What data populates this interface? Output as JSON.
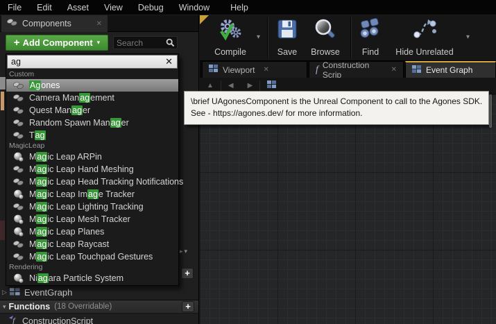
{
  "menu": {
    "items": [
      "File",
      "Edit",
      "Asset",
      "View",
      "Debug",
      "Window",
      "Help"
    ]
  },
  "components_panel": {
    "tab_label": "Components",
    "add_component_label": "Add Component",
    "search_placeholder": "Search"
  },
  "dropdown": {
    "query": "ag",
    "sections": [
      {
        "label": "Custom",
        "items": [
          {
            "icon": "component",
            "selected": true,
            "parts": [
              "",
              "Ag",
              "ones"
            ]
          },
          {
            "icon": "component",
            "parts": [
              "Camera Man",
              "ag",
              "ement"
            ]
          },
          {
            "icon": "component",
            "parts": [
              "Quest Man",
              "ag",
              "er"
            ]
          },
          {
            "icon": "component",
            "parts": [
              "Random Spawn Man",
              "ag",
              "er"
            ]
          },
          {
            "icon": "component",
            "parts": [
              "T",
              "ag",
              ""
            ]
          }
        ]
      },
      {
        "label": "MagicLeap",
        "items": [
          {
            "icon": "scene",
            "parts": [
              "M",
              "ag",
              "ic Leap ARPin"
            ]
          },
          {
            "icon": "component",
            "parts": [
              "M",
              "ag",
              "ic Leap Hand Meshing"
            ]
          },
          {
            "icon": "component",
            "parts": [
              "M",
              "ag",
              "ic Leap Head Tracking Notifications"
            ]
          },
          {
            "icon": "scene",
            "parts": [
              "M",
              "ag",
              "ic Leap Im",
              "ag",
              "e Tracker"
            ]
          },
          {
            "icon": "component",
            "parts": [
              "M",
              "ag",
              "ic Leap Lighting Tracking"
            ]
          },
          {
            "icon": "scene",
            "parts": [
              "M",
              "ag",
              "ic Leap Mesh Tracker"
            ]
          },
          {
            "icon": "scene",
            "parts": [
              "M",
              "ag",
              "ic Leap Planes"
            ]
          },
          {
            "icon": "component",
            "parts": [
              "M",
              "ag",
              "ic Leap Raycast"
            ]
          },
          {
            "icon": "component",
            "parts": [
              "M",
              "ag",
              "ic Leap Touchpad Gestures"
            ]
          }
        ]
      },
      {
        "label": "Rendering",
        "items": [
          {
            "icon": "scene",
            "parts": [
              "Ni",
              "ag",
              "ara Particle System"
            ]
          }
        ]
      }
    ]
  },
  "toolbar": {
    "buttons": [
      {
        "label": "Compile",
        "icon": "compile-icon"
      },
      {
        "label": "Save",
        "icon": "save-icon"
      },
      {
        "label": "Browse",
        "icon": "browse-icon"
      },
      {
        "label": "Find",
        "icon": "find-icon"
      },
      {
        "label": "Hide Unrelated",
        "icon": "hide-unrelated-icon"
      }
    ]
  },
  "doc_tabs": [
    {
      "label": "Viewport",
      "icon": "grid",
      "active": false
    },
    {
      "label": "Construction Scrip",
      "icon": "function",
      "active": false
    },
    {
      "label": "Event Graph",
      "icon": "grid",
      "active": true
    }
  ],
  "tooltip": {
    "line1": "\\brief UAgonesComponent is the Unreal Component to call to the Agones SDK.",
    "line2": "See - https://agones.dev/ for more information."
  },
  "my_blueprint": {
    "eventgraph_label": "EventGraph",
    "functions_label": "Functions",
    "functions_meta": "(18 Overridable)",
    "construction_script_label": "ConstructionScript"
  },
  "icons": {
    "close": "✕",
    "caret_down": "▾",
    "plus": "+",
    "expander_collapsed": "▷",
    "expander_expanded": "▾",
    "nav_up": "▲",
    "nav_left": "◀",
    "nav_right": "▶"
  },
  "colors": {
    "add_component_green": "#4a9a3c",
    "match_highlight_green": "#389738",
    "selected_row_gray": "#8c8c8c",
    "active_tab_yellow": "#d4a93c",
    "compile_check_green": "#3fae3f",
    "tooltip_background": "#f3f2ee"
  }
}
